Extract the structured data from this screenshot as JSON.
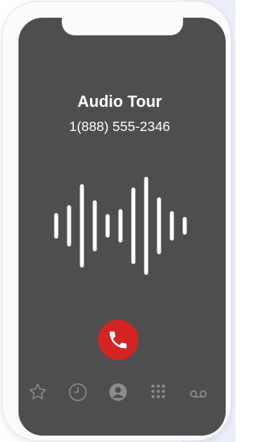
{
  "call": {
    "title": "Audio Tour",
    "number": "1(888) 555-2346"
  },
  "waveform": {
    "levels": [
      0.26,
      0.42,
      0.85,
      0.52,
      0.24,
      0.34,
      0.78,
      1.0,
      0.58,
      0.3,
      0.18
    ]
  },
  "colors": {
    "screen": "#4e4e4e",
    "end_call": "#d32323",
    "waveform": "#ffffff",
    "tab_icons": "#8c8c8c"
  },
  "icons": {
    "end_call": "phone-hangup-icon",
    "tabs": [
      "star-icon",
      "clock-icon",
      "contact-icon",
      "keypad-icon",
      "voicemail-icon"
    ]
  }
}
